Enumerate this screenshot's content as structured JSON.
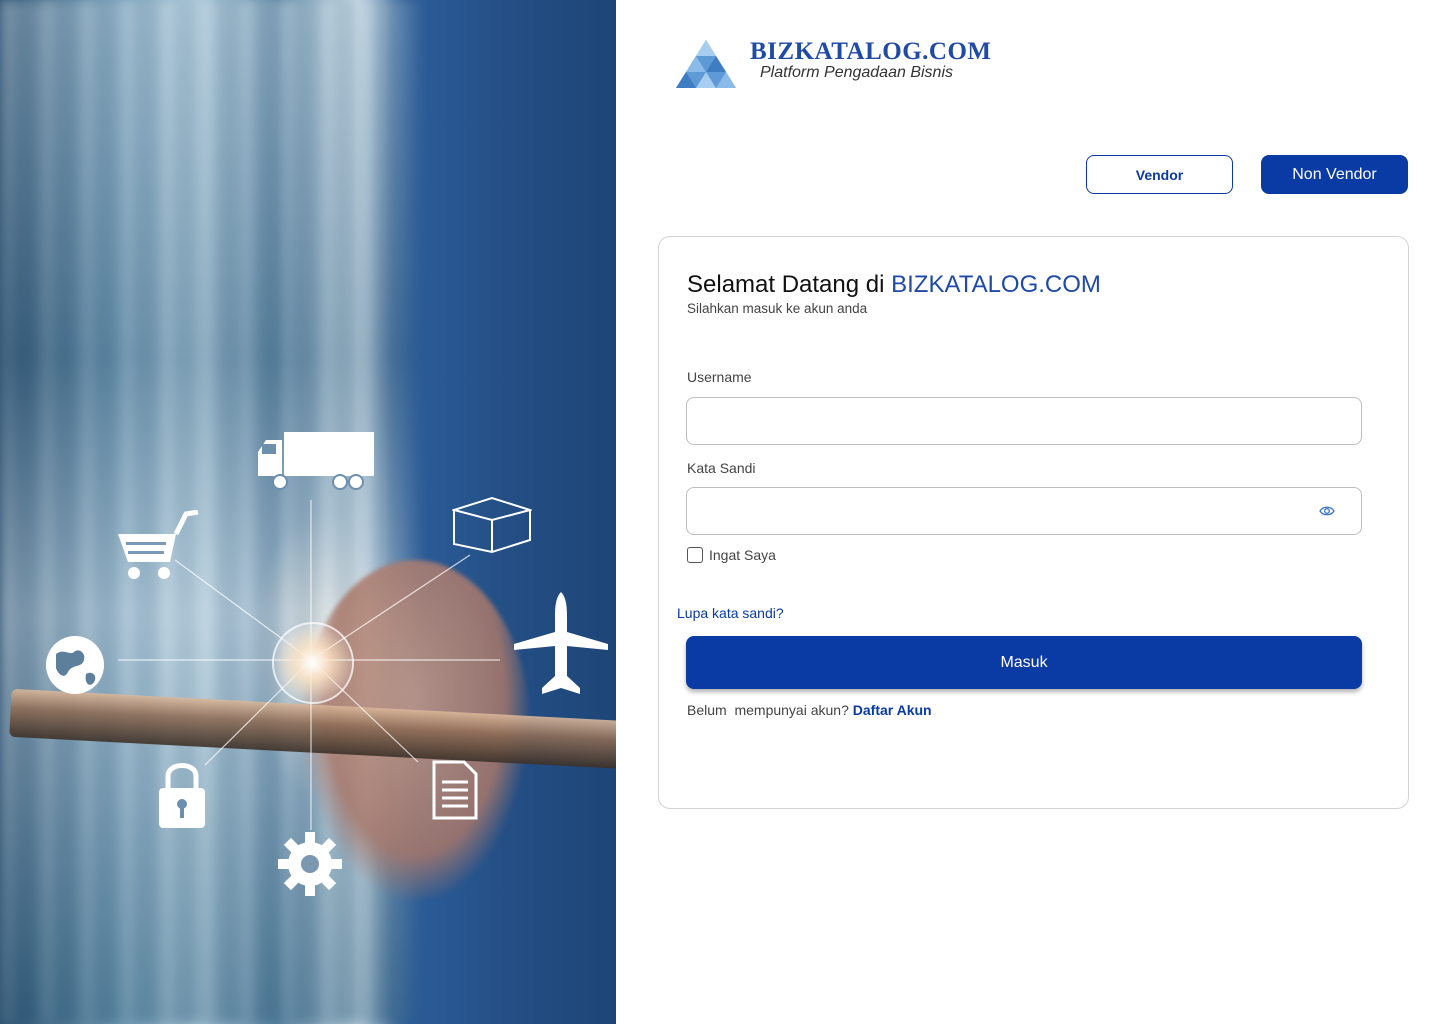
{
  "logo": {
    "brand": "BIZKATALOG.COM",
    "tagline": "Platform Pengadaan Bisnis"
  },
  "role_toggle": {
    "vendor_label": "Vendor",
    "non_vendor_label": "Non Vendor",
    "selected": "Non Vendor"
  },
  "login": {
    "title_prefix": "Selamat Datang di ",
    "title_brand": "BIZKATALOG.COM",
    "subtitle": "Silahkan masuk ke akun anda",
    "username_label": "Username",
    "username_value": "",
    "password_label": "Kata Sandi",
    "password_value": "",
    "remember_label": "Ingat Saya",
    "remember_checked": false,
    "forgot_label": "Lupa kata sandi?",
    "submit_label": "Masuk",
    "signup_prompt": "Belum  mempunyai akun? ",
    "signup_link": "Daftar Akun"
  },
  "hero_icons": [
    "truck-icon",
    "box-icon",
    "cart-icon",
    "airplane-icon",
    "globe-icon",
    "lock-icon",
    "document-icon",
    "gear-icon"
  ],
  "colors": {
    "primary": "#0a3aa3",
    "brand_text": "#1f4aa6",
    "border": "#d3d3d3"
  }
}
